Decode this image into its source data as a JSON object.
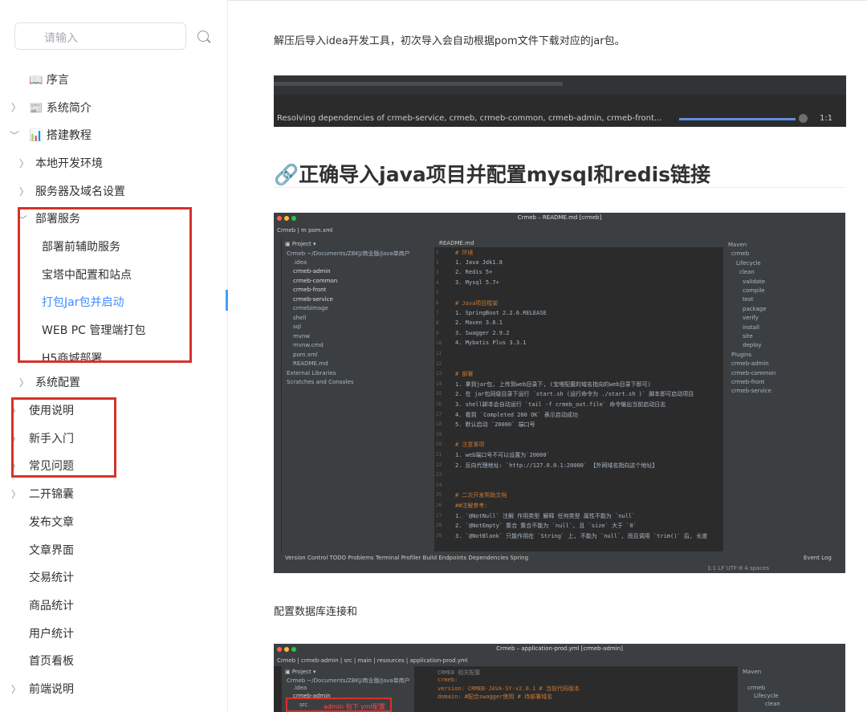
{
  "search": {
    "placeholder": "请输入"
  },
  "sidebar": {
    "items": [
      {
        "label": "📖 序言"
      },
      {
        "label": "📰 系统简介"
      },
      {
        "label": "📊 搭建教程"
      },
      {
        "label": "本地开发环境"
      },
      {
        "label": "服务器及域名设置"
      },
      {
        "label": "部署服务"
      },
      {
        "label": "部署前辅助服务"
      },
      {
        "label": "宝塔中配置和站点"
      },
      {
        "label": "打包Jar包并启动"
      },
      {
        "label": "WEB PC 管理端打包"
      },
      {
        "label": "H5商城部署"
      },
      {
        "label": "系统配置"
      },
      {
        "label": "使用说明"
      },
      {
        "label": "新手入门"
      },
      {
        "label": "常见问题"
      },
      {
        "label": "二开锦囊"
      },
      {
        "label": "发布文章"
      },
      {
        "label": "文章界面"
      },
      {
        "label": "交易统计"
      },
      {
        "label": "商品统计"
      },
      {
        "label": "用户统计"
      },
      {
        "label": "首页看板"
      },
      {
        "label": "前端说明"
      }
    ]
  },
  "content": {
    "intro": "解压后导入idea开发工具，初次导入会自动根据pom文件下载对应的jar包。",
    "strip_status": "Resolving dependencies of crmeb-service, crmeb, crmeb-common, crmeb-admin, crmeb-front...",
    "strip_pos": "1:1",
    "heading": "🔗正确导入java项目并配置mysql和redis链接",
    "para2": "配置数据库连接和",
    "ide1_title": "Crmeb – README.md [crmeb]",
    "ide1_crumb": "Crmeb | m pom.xml",
    "ide1_project_tree": [
      "Crmeb ~/Documents/ZBKJ/商业版/Java单商户",
      ".idea",
      "crmeb-admin",
      "crmeb-common",
      "crmeb-front",
      "crmeb-service",
      "crmebimage",
      "shell",
      "sql",
      "mvnw",
      "mvnw.cmd",
      "pom.xml",
      "README.md",
      "External Libraries",
      "Scratches and Consoles"
    ],
    "ide1_code": [
      "# 环境",
      "1. Java Jdk1.8",
      "2. Redis 5+",
      "3. Mysql 5.7+",
      "",
      "# Java项目框架",
      "1. SpringBoot 2.2.6.RELEASE",
      "2. Maven 3.6.1",
      "3. Swagger 2.9.2",
      "4. Mybatis Plus 3.3.1",
      "",
      "",
      "# 部署",
      "1. 拿到jar包, 上传到web目录下, (宝塔配置的域名指向的web目录下即可)",
      "2. 在 jar包同级目录下运行 `start.sh (运行命令为 ./start.sh )` 脚本即可启动项目",
      "3. shell脚本会自动运行 `tail -f crmeb_out.file` 命令输出当前启动日志",
      "4. 看到 `Completed 200 OK` 表示启动成功",
      "5. 默认启动 `20000` 端口号",
      "",
      "# 注意事项",
      "1. web端口号不可以设置为`20000`",
      "2. 反向代理地址: `http://127.0.0.1:20000` 【外网域名指向这个地址】",
      "",
      "",
      "# 二次开发帮助文档",
      "##注解参考:",
      "1. `@NotNull`   注解  作用类型 解释 任何类型 属性不能为 `null`",
      "2. `@NotEmpty`  集合 集合不能为 `null`, 且 `size` 大于 `0`",
      "3. `@NotBlank`  只能作用在 `String` 上, 不能为 `null`, 而且调用 `trim()` 后, 长度"
    ],
    "ide1_maven": [
      "Maven",
      "crmeb",
      "Lifecycle",
      "clean",
      "validate",
      "compile",
      "test",
      "package",
      "verify",
      "install",
      "site",
      "deploy",
      "Plugins",
      "crmeb-admin",
      "crmeb-common",
      "crmeb-front",
      "crmeb-service"
    ],
    "ide1_bottom": "Version Control   TODO   Problems   Terminal   Profiler   Build   Endpoints   Dependencies   Spring",
    "ide1_event": "Event Log",
    "ide1_status": "1:1  LF  UTF-8  4 spaces",
    "ide2_title": "Crmeb – application-prod.yml [crmeb-admin]",
    "ide2_crumb": "Crmeb | crmeb-admin | src | main | resources | application-prod.yml",
    "ide2_tree": [
      "Crmeb ~/Documents/ZBKJ/商业版/Java单商户",
      ".idea",
      "crmeb-admin",
      "src"
    ],
    "ide2_annot": "admin 包下 yml配置",
    "ide2_code": [
      "CRMEB 相关配置",
      "crmeb:",
      "  version: CRMEB-JAVA-SY-v2.0.1 # 当前代码版本",
      "  domain: #配合swagger使用 # 待部署域名"
    ],
    "ide2_maven": [
      "Maven",
      "crmeb",
      "Lifecycle",
      "clean"
    ]
  },
  "colors": {
    "accent": "#409eff",
    "highlight": "#d6322b"
  }
}
